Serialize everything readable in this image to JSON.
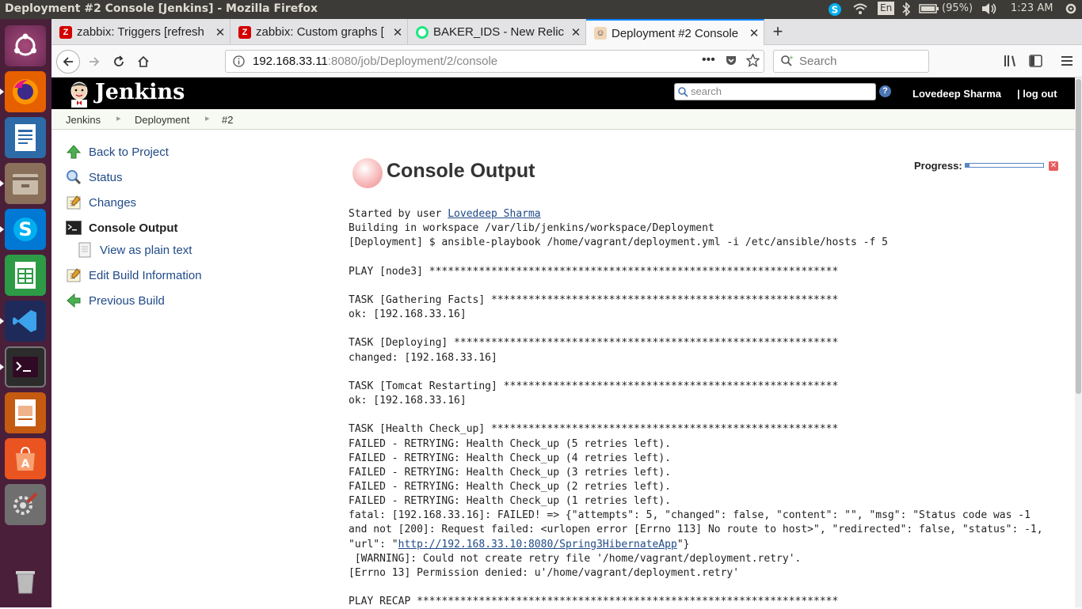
{
  "window_title": "Deployment #2 Console [Jenkins] - Mozilla Firefox",
  "tray": {
    "keyboard": "En",
    "battery": "(95%)",
    "time": "1:23 AM",
    "icons": [
      "skype-tray-icon",
      "wifi-icon",
      "keyboard-layout-icon",
      "bluetooth-icon",
      "battery-icon",
      "volume-icon",
      "settings-icon"
    ]
  },
  "launcher": {
    "items": [
      "ubuntu-dash",
      "firefox",
      "libreoffice-writer",
      "files",
      "skype",
      "libreoffice-calc",
      "visual-studio-code",
      "terminal",
      "libreoffice-impress",
      "software-center",
      "system-settings",
      "trash"
    ]
  },
  "tabs": [
    {
      "label": "zabbix: Triggers [refresh",
      "favicon": "Z"
    },
    {
      "label": "zabbix: Custom graphs [",
      "favicon": "Z"
    },
    {
      "label": "BAKER_IDS - New Relic",
      "favicon": "NR"
    },
    {
      "label": "Deployment #2 Console",
      "favicon": "J"
    }
  ],
  "urlbar": {
    "host": "192.168.33.11",
    "path": ":8080/job/Deployment/2/console"
  },
  "search": {
    "placeholder": "Search"
  },
  "jenkins": {
    "logo": "Jenkins",
    "search_placeholder": "search",
    "user": "Lovedeep Sharma",
    "logout": "| log out"
  },
  "breadcrumb": [
    "Jenkins",
    "Deployment",
    "#2"
  ],
  "side_tasks": [
    {
      "label": "Back to Project"
    },
    {
      "label": "Status"
    },
    {
      "label": "Changes"
    },
    {
      "label": "Console Output"
    },
    {
      "label": "View as plain text"
    },
    {
      "label": "Edit Build Information"
    },
    {
      "label": "Previous Build"
    }
  ],
  "main": {
    "title": "Console Output",
    "progress_label": "Progress:",
    "progress_fraction": 0.05,
    "console": {
      "started_by_prefix": "Started by user ",
      "started_by_user": "Lovedeep Sharma",
      "lines_a": [
        "Building in workspace /var/lib/jenkins/workspace/Deployment",
        "[Deployment] $ ansible-playbook /home/vagrant/deployment.yml -i /etc/ansible/hosts -f 5",
        "",
        "PLAY [node3] ******************************************************************",
        "",
        "TASK [Gathering Facts] ********************************************************",
        "ok: [192.168.33.16]",
        "",
        "TASK [Deploying] **************************************************************",
        "changed: [192.168.33.16]",
        "",
        "TASK [Tomcat Restarting] ******************************************************",
        "ok: [192.168.33.16]",
        "",
        "TASK [Health Check_up] ********************************************************",
        "FAILED - RETRYING: Health Check_up (5 retries left).",
        "FAILED - RETRYING: Health Check_up (4 retries left).",
        "FAILED - RETRYING: Health Check_up (3 retries left).",
        "FAILED - RETRYING: Health Check_up (2 retries left).",
        "FAILED - RETRYING: Health Check_up (1 retries left).",
        "fatal: [192.168.33.16]: FAILED! => {\"attempts\": 5, \"changed\": false, \"content\": \"\", \"msg\": \"Status code was -1",
        "and not [200]: Request failed: <urlopen error [Errno 113] No route to host>\", \"redirected\": false, \"status\": -1,"
      ],
      "url_line_prefix": "\"url\": \"",
      "url_link": "http://192.168.33.10:8080/Spring3HibernateApp",
      "url_line_suffix": "\"}",
      "lines_b": [
        " [WARNING]: Could not create retry file '/home/vagrant/deployment.retry'.",
        "[Errno 13] Permission denied: u'/home/vagrant/deployment.retry'",
        "",
        "PLAY RECAP ********************************************************************"
      ]
    }
  }
}
